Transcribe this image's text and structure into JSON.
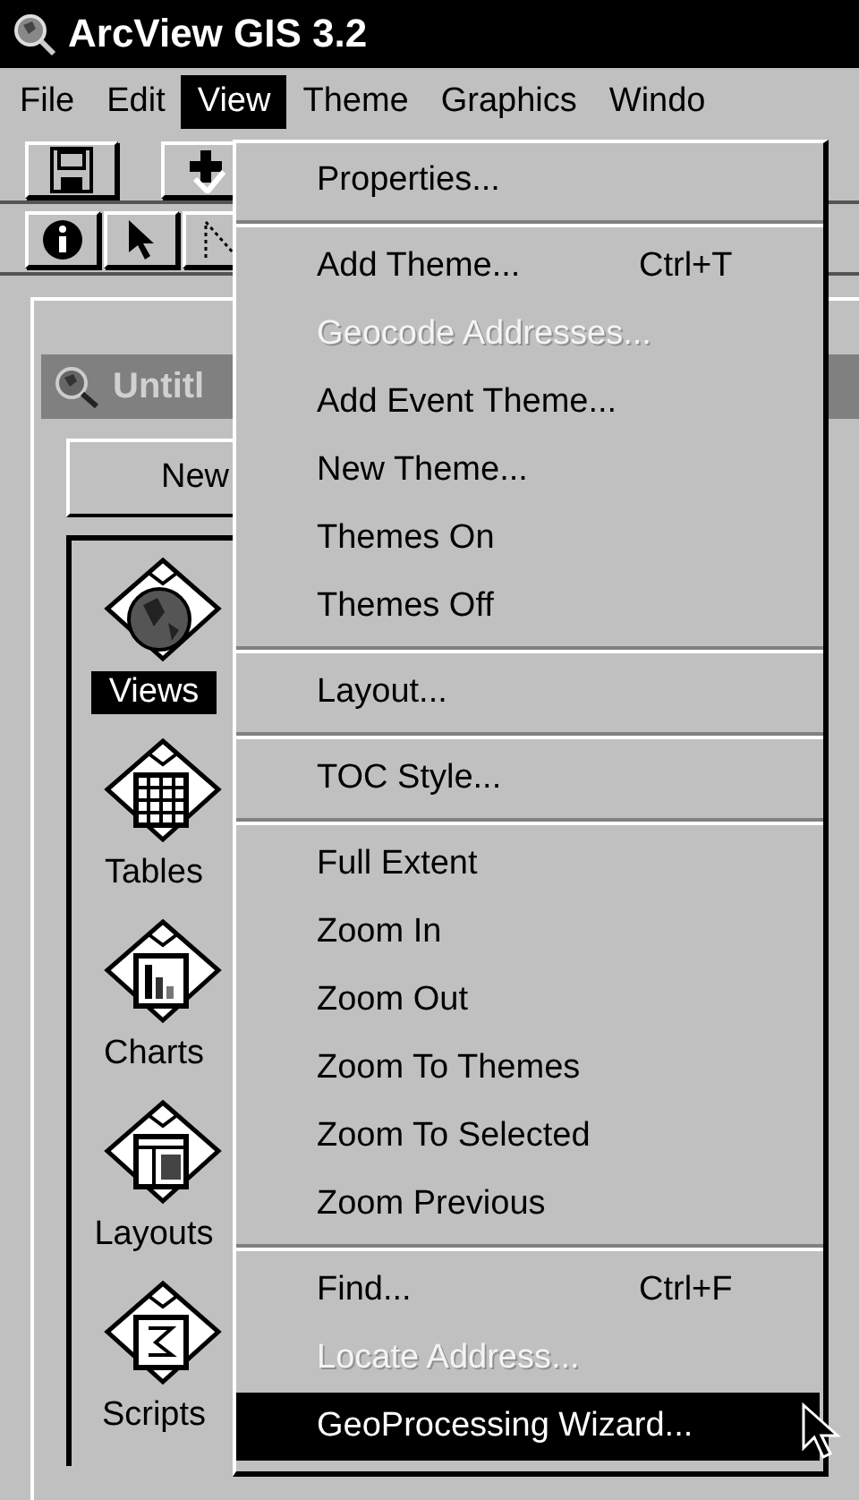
{
  "window": {
    "title": "ArcView GIS 3.2"
  },
  "menu_bar": [
    {
      "label": "File",
      "selected": false
    },
    {
      "label": "Edit",
      "selected": false
    },
    {
      "label": "View",
      "selected": true
    },
    {
      "label": "Theme",
      "selected": false
    },
    {
      "label": "Graphics",
      "selected": false
    },
    {
      "label": "Windo",
      "selected": false
    }
  ],
  "project_window": {
    "title": "Untitl",
    "active": false,
    "new_button": "New",
    "doc_types": [
      {
        "label": "Views",
        "kind": "views",
        "selected": true
      },
      {
        "label": "Tables",
        "kind": "tables",
        "selected": false
      },
      {
        "label": "Charts",
        "kind": "charts",
        "selected": false
      },
      {
        "label": "Layouts",
        "kind": "layouts",
        "selected": false
      },
      {
        "label": "Scripts",
        "kind": "scripts",
        "selected": false
      }
    ]
  },
  "view_menu": [
    [
      {
        "label": "Properties...",
        "disabled": false,
        "selected": false
      }
    ],
    [
      {
        "label": "Add Theme...",
        "shortcut": "Ctrl+T",
        "disabled": false,
        "selected": false
      },
      {
        "label": "Geocode Addresses...",
        "disabled": true,
        "selected": false
      },
      {
        "label": "Add Event Theme...",
        "disabled": false,
        "selected": false
      },
      {
        "label": "New Theme...",
        "disabled": false,
        "selected": false
      },
      {
        "label": "Themes On",
        "disabled": false,
        "selected": false
      },
      {
        "label": "Themes Off",
        "disabled": false,
        "selected": false
      }
    ],
    [
      {
        "label": "Layout...",
        "disabled": false,
        "selected": false
      }
    ],
    [
      {
        "label": "TOC Style...",
        "disabled": false,
        "selected": false
      }
    ],
    [
      {
        "label": "Full Extent",
        "disabled": false,
        "selected": false
      },
      {
        "label": "Zoom In",
        "disabled": false,
        "selected": false
      },
      {
        "label": "Zoom Out",
        "disabled": false,
        "selected": false
      },
      {
        "label": "Zoom To Themes",
        "disabled": false,
        "selected": false
      },
      {
        "label": "Zoom To Selected",
        "disabled": false,
        "selected": false
      },
      {
        "label": "Zoom Previous",
        "disabled": false,
        "selected": false
      }
    ],
    [
      {
        "label": "Find...",
        "shortcut": "Ctrl+F",
        "disabled": false,
        "selected": false
      },
      {
        "label": "Locate Address...",
        "disabled": true,
        "selected": false
      },
      {
        "label": "GeoProcessing Wizard...",
        "disabled": false,
        "selected": true
      }
    ]
  ]
}
